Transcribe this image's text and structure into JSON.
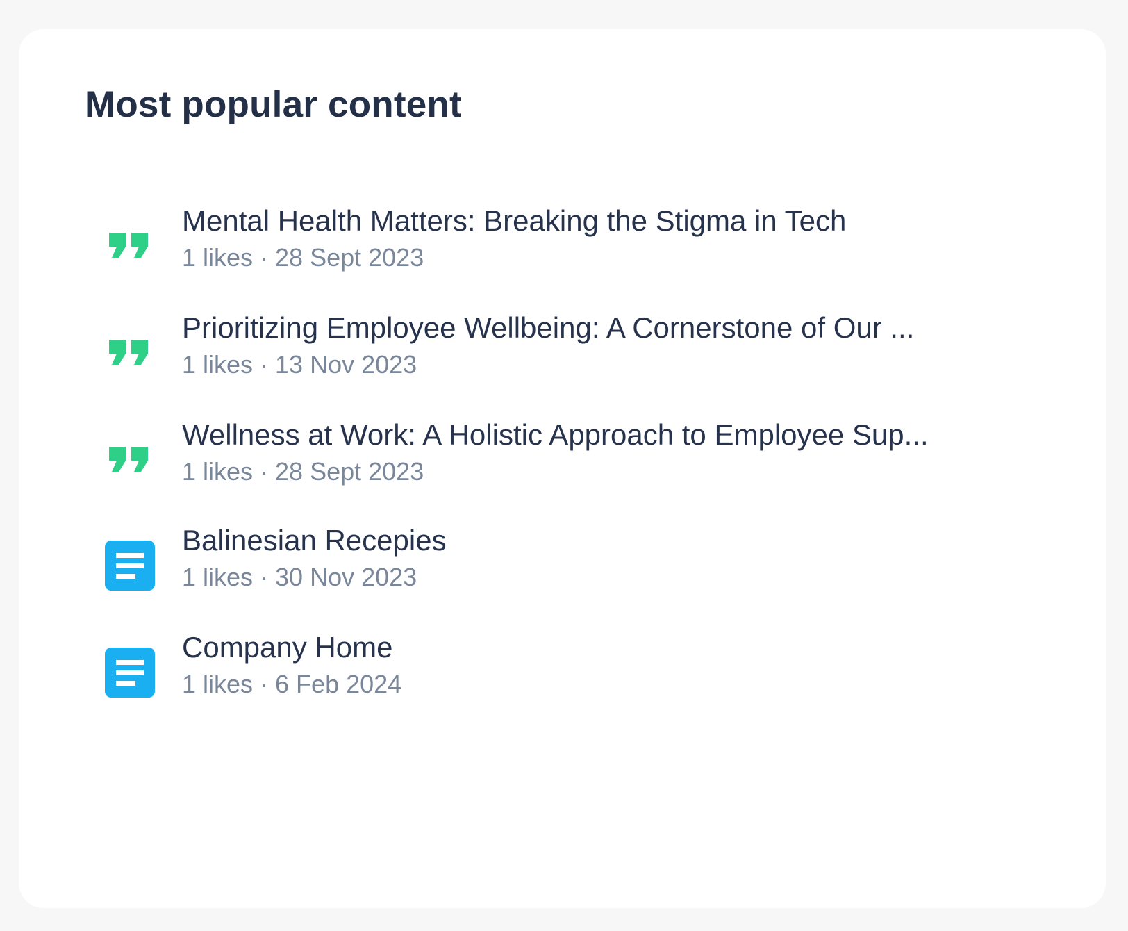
{
  "card": {
    "title": "Most popular content"
  },
  "items": [
    {
      "type": "quote",
      "icon": "quote-icon",
      "icon_color": "#2ecf86",
      "title": "Mental Health Matters: Breaking the Stigma in Tech",
      "meta": "1 likes · 28 Sept 2023"
    },
    {
      "type": "quote",
      "icon": "quote-icon",
      "icon_color": "#2ecf86",
      "title": "Prioritizing Employee Wellbeing: A Cornerstone of Our ...",
      "meta": "1 likes · 13 Nov 2023"
    },
    {
      "type": "quote",
      "icon": "quote-icon",
      "icon_color": "#2ecf86",
      "title": "Wellness at Work: A Holistic Approach to Employee Sup...",
      "meta": "1 likes · 28 Sept 2023"
    },
    {
      "type": "page",
      "icon": "document-icon",
      "icon_color": "#1aaff0",
      "title": "Balinesian Recepies",
      "meta": "1 likes · 30 Nov 2023"
    },
    {
      "type": "page",
      "icon": "document-icon",
      "icon_color": "#1aaff0",
      "title": "Company Home",
      "meta": "1 likes · 6 Feb 2024"
    }
  ]
}
